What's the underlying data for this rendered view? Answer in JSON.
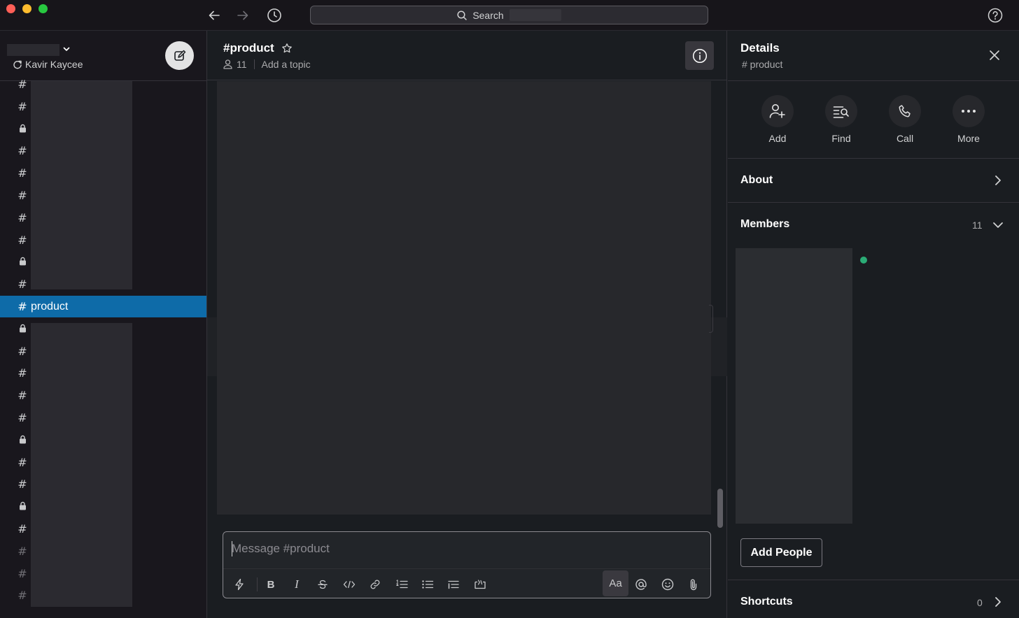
{
  "titlebar": {
    "search_label": "Search"
  },
  "sidebar": {
    "user_name": "Kavir Kaycee",
    "active_channel": "product",
    "items": [
      {
        "type": "hash",
        "label": ""
      },
      {
        "type": "hash",
        "label": ""
      },
      {
        "type": "lock",
        "label": ""
      },
      {
        "type": "hash",
        "label": ""
      },
      {
        "type": "hash",
        "label": ""
      },
      {
        "type": "hash",
        "label": ""
      },
      {
        "type": "hash",
        "label": ""
      },
      {
        "type": "hash",
        "label": ""
      },
      {
        "type": "lock",
        "label": ""
      },
      {
        "type": "hash",
        "label": ""
      },
      {
        "type": "hash",
        "label": "product"
      },
      {
        "type": "lock",
        "label": ""
      },
      {
        "type": "hash",
        "label": ""
      },
      {
        "type": "hash",
        "label": ""
      },
      {
        "type": "hash",
        "label": ""
      },
      {
        "type": "hash",
        "label": ""
      },
      {
        "type": "lock",
        "label": ""
      },
      {
        "type": "hash",
        "label": ""
      },
      {
        "type": "hash",
        "label": ""
      },
      {
        "type": "lock",
        "label": ""
      },
      {
        "type": "hash",
        "label": ""
      },
      {
        "type": "hash-dim",
        "label": ""
      },
      {
        "type": "hash-dim",
        "label": ""
      },
      {
        "type": "hash-dim",
        "label": ""
      }
    ]
  },
  "channel": {
    "title": "#product",
    "member_count": "11",
    "topic_link": "Add a topic"
  },
  "composer": {
    "placeholder": "Message #product",
    "format_label": "Aa"
  },
  "details": {
    "title": "Details",
    "subtitle": "# product",
    "actions": [
      {
        "label": "Add",
        "icon": "add-person-icon"
      },
      {
        "label": "Find",
        "icon": "find-in-channel-icon"
      },
      {
        "label": "Call",
        "icon": "phone-icon"
      },
      {
        "label": "More",
        "icon": "more-icon"
      }
    ],
    "about_label": "About",
    "members_label": "Members",
    "members_count": "11",
    "add_people_label": "Add People",
    "shortcuts_label": "Shortcuts",
    "shortcuts_count": "0"
  },
  "colors": {
    "active_channel_bg": "#0e6ba8",
    "online_status": "#2bac76"
  }
}
